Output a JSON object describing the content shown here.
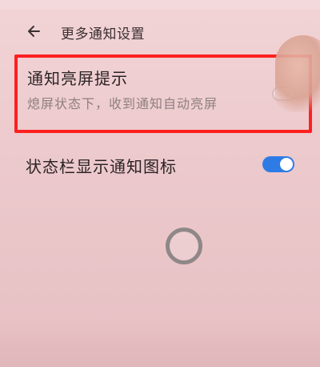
{
  "header": {
    "title": "更多通知设置",
    "back_icon": "back-arrow-icon"
  },
  "settings": {
    "screen_wake": {
      "title": "通知亮屏提示",
      "description": "熄屏状态下，收到通知自动亮屏",
      "enabled": false
    },
    "status_bar_icon": {
      "title": "状态栏显示通知图标",
      "enabled": true
    }
  },
  "colors": {
    "highlight_border": "#ff2020",
    "toggle_on": "#2f7be6",
    "background": "#ecc9cc"
  }
}
